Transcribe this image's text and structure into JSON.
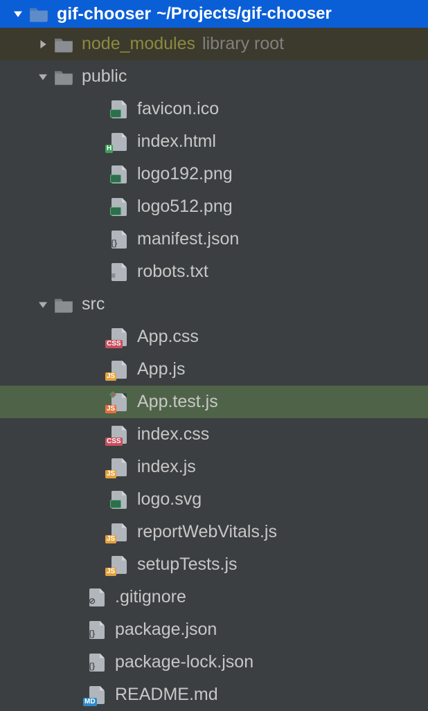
{
  "root": {
    "name": "gif-chooser",
    "path": "~/Projects/gif-chooser",
    "expanded": true
  },
  "tree": [
    {
      "indent": 1,
      "type": "folder",
      "name": "node_modules",
      "expanded": false,
      "excluded": true,
      "suffix": "library root",
      "highlight": "library"
    },
    {
      "indent": 1,
      "type": "folder",
      "name": "public",
      "expanded": true
    },
    {
      "indent": 3,
      "type": "file",
      "name": "favicon.ico",
      "fileKind": "image"
    },
    {
      "indent": 3,
      "type": "file",
      "name": "index.html",
      "fileKind": "html"
    },
    {
      "indent": 3,
      "type": "file",
      "name": "logo192.png",
      "fileKind": "image"
    },
    {
      "indent": 3,
      "type": "file",
      "name": "logo512.png",
      "fileKind": "image"
    },
    {
      "indent": 3,
      "type": "file",
      "name": "manifest.json",
      "fileKind": "json"
    },
    {
      "indent": 3,
      "type": "file",
      "name": "robots.txt",
      "fileKind": "txt"
    },
    {
      "indent": 1,
      "type": "folder",
      "name": "src",
      "expanded": true
    },
    {
      "indent": 3,
      "type": "file",
      "name": "App.css",
      "fileKind": "css"
    },
    {
      "indent": 3,
      "type": "file",
      "name": "App.js",
      "fileKind": "js"
    },
    {
      "indent": 3,
      "type": "file",
      "name": "App.test.js",
      "fileKind": "jstest",
      "selected": true
    },
    {
      "indent": 3,
      "type": "file",
      "name": "index.css",
      "fileKind": "css"
    },
    {
      "indent": 3,
      "type": "file",
      "name": "index.js",
      "fileKind": "js"
    },
    {
      "indent": 3,
      "type": "file",
      "name": "logo.svg",
      "fileKind": "image"
    },
    {
      "indent": 3,
      "type": "file",
      "name": "reportWebVitals.js",
      "fileKind": "js"
    },
    {
      "indent": 3,
      "type": "file",
      "name": "setupTests.js",
      "fileKind": "js"
    },
    {
      "indent": 2,
      "type": "file",
      "name": ".gitignore",
      "fileKind": "ignore"
    },
    {
      "indent": 2,
      "type": "file",
      "name": "package.json",
      "fileKind": "json"
    },
    {
      "indent": 2,
      "type": "file",
      "name": "package-lock.json",
      "fileKind": "json"
    },
    {
      "indent": 2,
      "type": "file",
      "name": "README.md",
      "fileKind": "md"
    }
  ]
}
